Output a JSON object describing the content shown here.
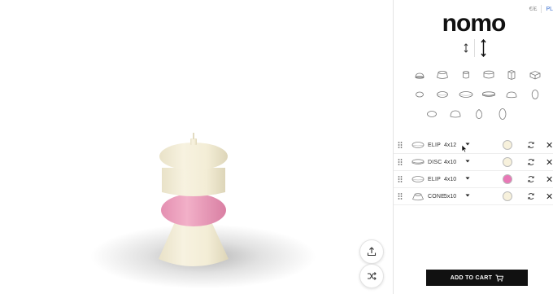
{
  "brand": {
    "logo": "nomo"
  },
  "corner": {
    "icon_label": "€/£",
    "tab_label": "PL"
  },
  "layers": [
    {
      "name": "ELIP",
      "size": "4x12",
      "color": "#f7f1dc"
    },
    {
      "name": "DISC",
      "size": "4x10",
      "color": "#f7f1dc"
    },
    {
      "name": "ELIP",
      "size": "4x10",
      "color": "#e878b6"
    },
    {
      "name": "CONE",
      "size": "5x10",
      "color": "#f7f1dc"
    }
  ],
  "shape_icons": [
    [
      "dome-flat-icon",
      "drum-wide-icon",
      "cylinder-small-icon",
      "cylinder-wide-icon",
      "box-icon",
      "cube-icon"
    ],
    [
      "ellipse-small-icon",
      "ellipse-medium-icon",
      "ellipse-large-icon",
      "disc-icon",
      "dome-half-icon",
      "egg-icon"
    ],
    [
      "ellipse-wide-icon",
      "dome-round-icon",
      "egg-tall-icon",
      "oval-tall-icon"
    ]
  ],
  "cart": {
    "label": "ADD TO CART"
  },
  "colors": {
    "cream": "#f7f1dc",
    "pink": "#e878b6",
    "dark": "#111111"
  }
}
